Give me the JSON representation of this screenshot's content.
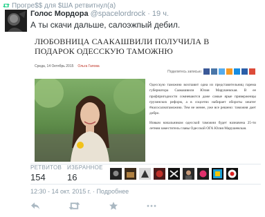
{
  "retweet_bar": {
    "text": "Прогре$$ для $ША ретвитнул(а)"
  },
  "tweet": {
    "author_name": "Голос Мордора",
    "handle": "@spacelordrock",
    "separator": "·",
    "time": "19 ч.",
    "text": "А ты скачи дальше, салоэжпый дебил."
  },
  "article": {
    "title": "ЛЮБОВНИЦА СААКАШВИЛИ ПОЛУЧИЛА В ПОДАРОК ОДЕССКУЮ ТАМОЖНЮ",
    "date": "Среда, 14 Октябрь 2015",
    "author": "Ольга Гапова",
    "share_label": "Поделитесь записью:",
    "paragraphs": [
      "Одесскую таможню возглавит одна из представительниц гарема губернатора Саакашвили Юлия Марушевская. В ее профпригодности сомневаются даже самые ярые приверженцы грузинских реформ, а в соцсетях набирает обороты хештег #насосалнатаможню. Тем не менее, уже все решено: таможня дает добро.",
      "Новым начальником одесской таможни будет назначена 25-ти летняя заместитель главы Одесской ОГА Юлия Марушевская."
    ]
  },
  "stats": {
    "retweets_label": "РЕТВИТОВ",
    "retweets_count": "154",
    "favorites_label": "ИЗБРАННОЕ",
    "favorites_count": "16"
  },
  "footer": {
    "timestamp": "12:30 - 14 окт. 2015 г.",
    "separator": "·",
    "details_link": "Подробнее"
  },
  "icons": {
    "retweet": "retweet-icon",
    "reply": "reply-icon",
    "favorite": "star-icon",
    "more": "more-icon"
  },
  "colors": {
    "muted": "#8899a6",
    "text": "#292f33",
    "retweet_green": "#19cf86",
    "author_red": "#c0392b"
  }
}
